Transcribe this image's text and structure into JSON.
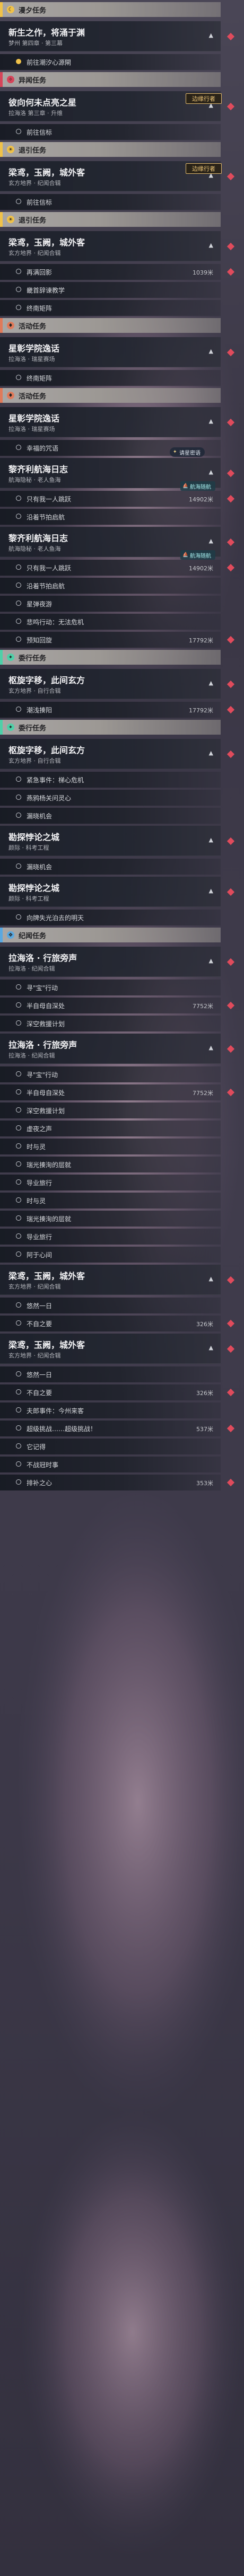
{
  "colors": {
    "main_bar": "#f0c24a",
    "world_bar": "#e07a5a",
    "activity_bar": "#e07a5a",
    "anomaly_bar": "#d6455a",
    "daily_bar": "#4ed0a8",
    "chronicle_bar": "#5aa8e0",
    "text_primary": "#f2f2f4",
    "badge_gold": "#f0c878",
    "marker_red": "#e04b5c"
  },
  "sections": [
    {
      "type": "header",
      "label": "漫夕任务",
      "icon": "moon-icon",
      "bar": "#f0c24a"
    },
    {
      "type": "card",
      "title": "新生之作，将涌于渊",
      "sub": "梦州 第四章 · 第三幕"
    },
    {
      "type": "obj",
      "text": "前往潮汐心源閘",
      "dot": "#f0c24a"
    },
    {
      "type": "header",
      "label": "异闻任务",
      "icon": "anomaly-icon",
      "bar": "#d6455a"
    },
    {
      "type": "card",
      "title": "彼向何未点亮之星",
      "sub": "拉海洛 第三章 · 升维"
    },
    {
      "type": "badge",
      "text": "边缘行者"
    },
    {
      "type": "obj",
      "text": "前往信标",
      "dot": "#c8cbd2"
    },
    {
      "type": "header",
      "label": "退引任务",
      "icon": "sun-icon",
      "bar": "#f0c24a"
    },
    {
      "type": "card",
      "title": "梁鸢，玉阙，城外客",
      "sub": "玄方地界 · 纪闻合辑"
    },
    {
      "type": "badge",
      "text": "边缘行者"
    },
    {
      "type": "obj",
      "text": "前往信标",
      "dot": "#c8cbd2"
    },
    {
      "type": "header",
      "label": "退引任务",
      "icon": "sun-icon",
      "bar": "#f0c24a"
    },
    {
      "type": "card",
      "title": "梁鸢，玉阙，城外客",
      "sub": "玄方地界 · 纪闻合辑"
    },
    {
      "type": "obj",
      "text": "再满回影",
      "dist": "1039米",
      "dot": "#c8cbd2"
    },
    {
      "type": "obj",
      "text": "畿首辞谏教学",
      "dot": "#c8cbd2"
    },
    {
      "type": "obj",
      "text": "终南矩阵",
      "dot": "#c8cbd2"
    },
    {
      "type": "header",
      "label": "活动任务",
      "icon": "activity-icon",
      "bar": "#e07a5a"
    },
    {
      "type": "card",
      "title": "星彰学院逸话",
      "sub": "拉海洛 · 瑞星赛场"
    },
    {
      "type": "obj",
      "text": "终南矩阵",
      "dot": "#c8cbd2"
    },
    {
      "type": "header",
      "label": "活动任务",
      "icon": "activity-icon",
      "bar": "#e07a5a"
    },
    {
      "type": "card",
      "title": "星彰学院逸话",
      "sub": "拉海洛 · 瑞星赛场"
    },
    {
      "type": "obj",
      "text": "幸福的咒语",
      "dot": "#c8cbd2"
    },
    {
      "type": "speech",
      "text": "请星密语"
    },
    {
      "type": "card",
      "title": "黎齐利航海日志",
      "sub": "航海隐秘 · 老人鱼海"
    },
    {
      "type": "ship",
      "text": "航海随航"
    },
    {
      "type": "obj",
      "text": "只有我一人跳跃",
      "dist": "14902米",
      "dot": "#c8cbd2"
    },
    {
      "type": "obj",
      "text": "沿着节拍启航",
      "dot": "#c8cbd2"
    },
    {
      "type": "card",
      "title": "黎齐利航海日志",
      "sub": "航海隐秘 · 老人鱼海"
    },
    {
      "type": "ship",
      "text": "航海随航"
    },
    {
      "type": "obj",
      "text": "只有我一人跳跃",
      "dist": "14902米",
      "dot": "#c8cbd2"
    },
    {
      "type": "obj",
      "text": "沿着节拍启航",
      "dot": "#c8cbd2"
    },
    {
      "type": "obj",
      "text": "星弹夜游",
      "dot": "#c8cbd2"
    },
    {
      "type": "obj",
      "text": "悲鸣行动：无法危机",
      "dot": "#c8cbd2"
    },
    {
      "type": "obj",
      "text": "预知回旋",
      "dist": "17792米",
      "dot": "#c8cbd2"
    },
    {
      "type": "header",
      "label": "委行任务",
      "icon": "daily-icon",
      "bar": "#4ed0a8"
    },
    {
      "type": "card",
      "title": "枢旋字移，此间玄方",
      "sub": "玄方地界 · 自行合辑"
    },
    {
      "type": "obj",
      "text": "潮浅揍阳",
      "dist": "17792米",
      "dot": "#c8cbd2"
    },
    {
      "type": "header",
      "label": "委行任务",
      "icon": "daily-icon",
      "bar": "#4ed0a8"
    },
    {
      "type": "card",
      "title": "枢旋字移，此间玄方",
      "sub": "玄方地界 · 自行合辑"
    },
    {
      "type": "obj",
      "text": "紧急事件：梯心危机",
      "dot": "#c8cbd2"
    },
    {
      "type": "obj",
      "text": "燕鸦杨关问灵心",
      "dot": "#c8cbd2"
    },
    {
      "type": "obj",
      "text": "漏晓机会",
      "dot": "#c8cbd2"
    },
    {
      "type": "card",
      "title": "勘探悖论之城",
      "sub": "颜际 · 科考工程"
    },
    {
      "type": "obj",
      "text": "漏晓机会",
      "dot": "#c8cbd2"
    },
    {
      "type": "card",
      "title": "勘探悖论之城",
      "sub": "颜际 · 科考工程"
    },
    {
      "type": "obj",
      "text": "向牌失光泊去的明天",
      "dot": "#c8cbd2"
    },
    {
      "type": "header",
      "label": "纪闻任务",
      "icon": "chronicle-icon",
      "bar": "#5aa8e0"
    },
    {
      "type": "card",
      "title": "拉海洛 · 行旅旁声",
      "sub": "拉海洛 · 纪闻合辑"
    },
    {
      "type": "obj",
      "text": "寻\"宝\"行动",
      "dot": "#c8cbd2"
    },
    {
      "type": "obj",
      "text": "半自母自深处",
      "dist": "7752米",
      "dot": "#c8cbd2"
    },
    {
      "type": "obj",
      "text": "深空救援计划",
      "dot": "#c8cbd2"
    },
    {
      "type": "card",
      "title": "拉海洛 · 行旅旁声",
      "sub": "拉海洛 · 纪闻合辑"
    },
    {
      "type": "obj",
      "text": "寻\"宝\"行动",
      "dot": "#c8cbd2"
    },
    {
      "type": "obj",
      "text": "半自母自深处",
      "dist": "7752米",
      "dot": "#c8cbd2"
    },
    {
      "type": "obj",
      "text": "深空救援计划",
      "dot": "#c8cbd2"
    },
    {
      "type": "obj",
      "text": "虚夜之声",
      "dot": "#c8cbd2"
    },
    {
      "type": "obj",
      "text": "时与灵",
      "dot": "#c8cbd2"
    },
    {
      "type": "obj",
      "text": "瑞光揍洵的层就",
      "dot": "#c8cbd2"
    },
    {
      "type": "obj",
      "text": "导业旅行",
      "dot": "#c8cbd2"
    },
    {
      "type": "obj",
      "text": "时与灵",
      "dot": "#c8cbd2"
    },
    {
      "type": "obj",
      "text": "瑞光揍洵的层就",
      "dot": "#c8cbd2"
    },
    {
      "type": "obj",
      "text": "导业旅行",
      "dot": "#c8cbd2"
    },
    {
      "type": "obj",
      "text": "阿于心间",
      "dot": "#c8cbd2"
    },
    {
      "type": "card",
      "title": "梁鸢，玉阙，城外客",
      "sub": "玄方地界 · 纪闻合辑"
    },
    {
      "type": "obj",
      "text": "悠然一日",
      "dot": "#c8cbd2"
    },
    {
      "type": "obj",
      "text": "不自之要",
      "dist": "326米",
      "dot": "#c8cbd2"
    },
    {
      "type": "card",
      "title": "梁鸢，玉阙，城外客",
      "sub": "玄方地界 · 纪闻合辑"
    },
    {
      "type": "obj",
      "text": "悠然一日",
      "dot": "#c8cbd2"
    },
    {
      "type": "obj",
      "text": "不自之要",
      "dist": "326米",
      "dot": "#c8cbd2"
    },
    {
      "type": "obj",
      "text": "夫郎事件：今州来客",
      "dot": "#c8cbd2"
    },
    {
      "type": "obj",
      "text": "超级挑战……超级挑战！",
      "dist": "537米",
      "dot": "#c8cbd2"
    },
    {
      "type": "obj",
      "text": "它记得",
      "dot": "#c8cbd2"
    },
    {
      "type": "obj",
      "text": "不战冠时事",
      "dot": "#c8cbd2"
    },
    {
      "type": "obj",
      "text": "排补之心",
      "dist": "353米",
      "dot": "#c8cbd2"
    }
  ]
}
